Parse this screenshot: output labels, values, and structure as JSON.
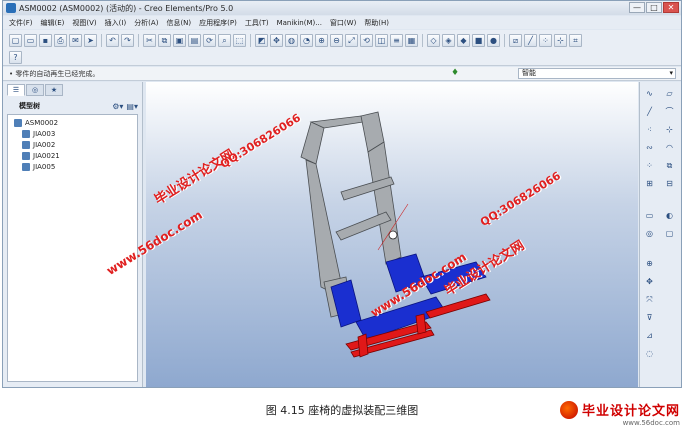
{
  "window": {
    "title": "ASM0002 (ASM0002) (活动的) - Creo Elements/Pro 5.0",
    "minimize": "—",
    "maximize": "□",
    "close": "✕"
  },
  "menu": [
    "文件(F)",
    "编辑(E)",
    "视图(V)",
    "插入(I)",
    "分析(A)",
    "信息(N)",
    "应用程序(P)",
    "工具(T)",
    "Manikin(M)...",
    "窗口(W)",
    "帮助(H)"
  ],
  "status": {
    "message": "• 零件的自动再生已经完成。",
    "filter_value": "智能",
    "filter_arrow": "▾"
  },
  "panel": {
    "tabs": [
      "☰",
      "◎",
      "★"
    ],
    "tree_label": "模型树",
    "tree_tools": [
      "⚙▾",
      "▤▾"
    ],
    "root": "ASM0002",
    "children": [
      "JIA003",
      "JIA002",
      "JIA0021",
      "JIA005"
    ]
  },
  "watermarks": {
    "cn_brand": "毕业设计论文网",
    "qq": "QQ:306826066",
    "site": "www.56doc.com"
  },
  "caption": "图 4.15 座椅的虚拟装配三维图",
  "logo": {
    "text": "毕业设计论文网",
    "url": "www.56doc.com"
  },
  "colors": {
    "frame_gray": "#a0a4a8",
    "base_blue": "#1a2fd0",
    "rail_red": "#e01818",
    "watermark_red": "#e02020"
  }
}
